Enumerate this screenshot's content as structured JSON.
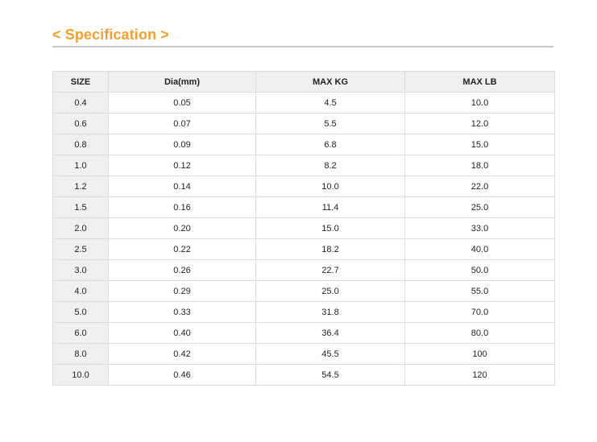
{
  "title": "< Specification >",
  "table": {
    "headers": [
      "SIZE",
      "Dia(mm)",
      "MAX KG",
      "MAX LB"
    ],
    "rows": [
      [
        "0.4",
        "0.05",
        "4.5",
        "10.0"
      ],
      [
        "0.6",
        "0.07",
        "5.5",
        "12.0"
      ],
      [
        "0.8",
        "0.09",
        "6.8",
        "15.0"
      ],
      [
        "1.0",
        "0.12",
        "8.2",
        "18.0"
      ],
      [
        "1.2",
        "0.14",
        "10.0",
        "22.0"
      ],
      [
        "1.5",
        "0.16",
        "11.4",
        "25.0"
      ],
      [
        "2.0",
        "0.20",
        "15.0",
        "33.0"
      ],
      [
        "2.5",
        "0.22",
        "18.2",
        "40.0"
      ],
      [
        "3.0",
        "0.26",
        "22.7",
        "50.0"
      ],
      [
        "4.0",
        "0.29",
        "25.0",
        "55.0"
      ],
      [
        "5.0",
        "0.33",
        "31.8",
        "70.0"
      ],
      [
        "6.0",
        "0.40",
        "36.4",
        "80.0"
      ],
      [
        "8.0",
        "0.42",
        "45.5",
        "100"
      ],
      [
        "10.0",
        "0.46",
        "54.5",
        "120"
      ]
    ]
  },
  "colors": {
    "title": "#f0a030",
    "header_bg": "#f0f0f0",
    "border": "#dcdcdc",
    "rule": "#c8c8c8"
  }
}
